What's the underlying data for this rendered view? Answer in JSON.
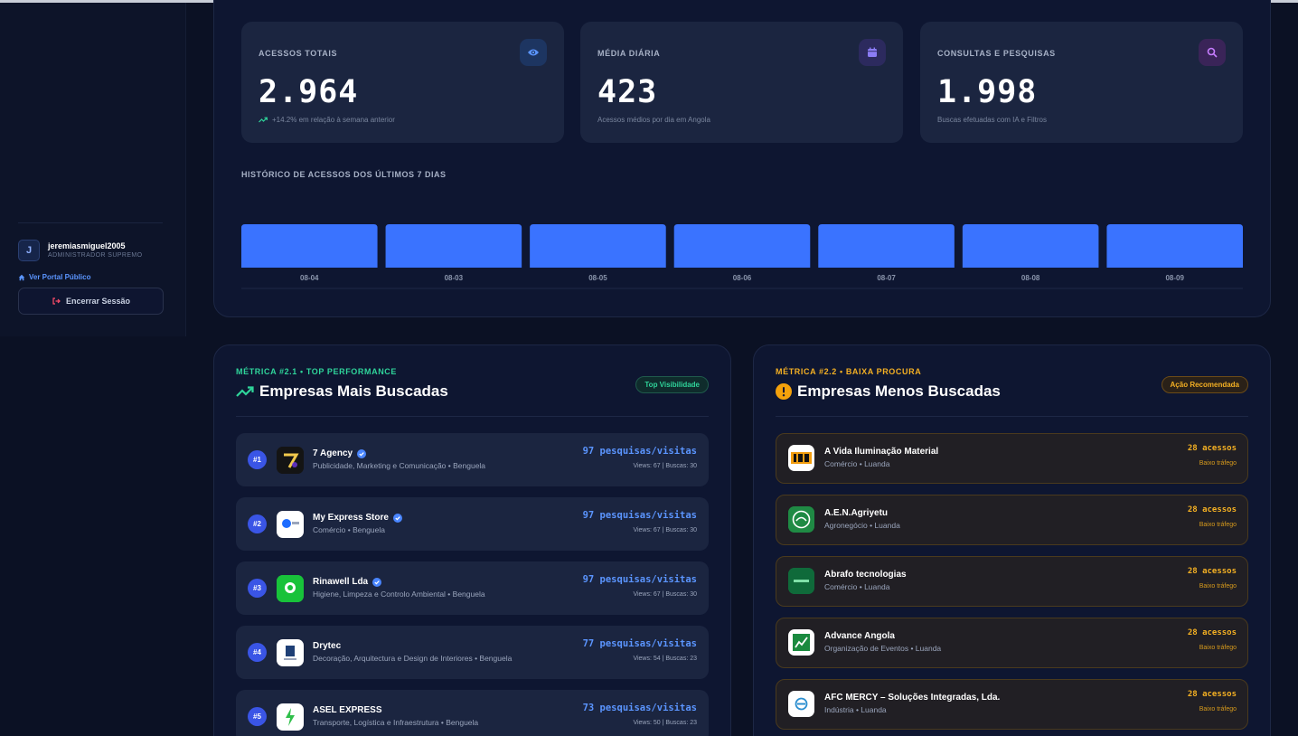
{
  "sidebar": {
    "user_initial": "J",
    "user_name": "jeremiasmiguel2005",
    "user_role": "ADMINISTRADOR SUPREMO",
    "portal_link": "Ver Portal Público",
    "logout_label": "Encerrar Sessão"
  },
  "stats": [
    {
      "label": "ACESSOS TOTAIS",
      "value": "2.964",
      "note": "+14.2% em relação à semana anterior",
      "icon": "eye-icon"
    },
    {
      "label": "MÉDIA DIÁRIA",
      "value": "423",
      "note": "Acessos médios por dia em Angola",
      "icon": "calendar-icon"
    },
    {
      "label": "CONSULTAS E PESQUISAS",
      "value": "1.998",
      "note": "Buscas efetuadas com IA e Filtros",
      "icon": "search-icon"
    }
  ],
  "history_title": "HISTÓRICO DE ACESSOS DOS ÚLTIMOS 7 DIAS",
  "chart_data": {
    "type": "bar",
    "categories": [
      "08-04",
      "08-03",
      "08-05",
      "08-06",
      "08-07",
      "08-08",
      "08-09"
    ],
    "values": [
      1,
      1,
      1,
      1,
      1,
      1,
      1
    ],
    "title": "HISTÓRICO DE ACESSOS DOS ÚLTIMOS 7 DIAS",
    "bar_color": "#3a73ff",
    "grid": false
  },
  "top": {
    "tag": "MÉTRICA #2.1 • TOP PERFORMANCE",
    "title": "Empresas Mais Buscadas",
    "badge": "Top Visibilidade",
    "items": [
      {
        "rank": "#1",
        "name": "7 Agency",
        "sub": "Publicidade, Marketing e Comunicação • Benguela",
        "stat": "97 pesquisas/visitas",
        "meta": "Views: 67 | Buscas: 30",
        "verified": true
      },
      {
        "rank": "#2",
        "name": "My Express Store",
        "sub": "Comércio • Benguela",
        "stat": "97 pesquisas/visitas",
        "meta": "Views: 67 | Buscas: 30",
        "verified": true
      },
      {
        "rank": "#3",
        "name": "Rinawell Lda",
        "sub": "Higiene, Limpeza e Controlo Ambiental • Benguela",
        "stat": "97 pesquisas/visitas",
        "meta": "Views: 67 | Buscas: 30",
        "verified": true
      },
      {
        "rank": "#4",
        "name": "Drytec",
        "sub": "Decoração, Arquitectura e Design de Interiores • Benguela",
        "stat": "77 pesquisas/visitas",
        "meta": "Views: 54 | Buscas: 23",
        "verified": false
      },
      {
        "rank": "#5",
        "name": "ASEL EXPRESS",
        "sub": "Transporte, Logística e Infraestrutura • Benguela",
        "stat": "73 pesquisas/visitas",
        "meta": "Views: 50 | Buscas: 23",
        "verified": false
      }
    ]
  },
  "low": {
    "tag": "MÉTRICA #2.2 • BAIXA PROCURA",
    "title": "Empresas Menos Buscadas",
    "badge": "Ação Recomendada",
    "items": [
      {
        "name": "A Vida Iluminação Material",
        "sub": "Comércio • Luanda",
        "stat": "28 acessos",
        "meta": "Baixo tráfego"
      },
      {
        "name": "A.E.N.Agriyetu",
        "sub": "Agronegócio • Luanda",
        "stat": "28 acessos",
        "meta": "Baixo tráfego"
      },
      {
        "name": "Abrafo tecnologias",
        "sub": "Comércio • Luanda",
        "stat": "28 acessos",
        "meta": "Baixo tráfego"
      },
      {
        "name": "Advance Angola",
        "sub": "Organização de Eventos • Luanda",
        "stat": "28 acessos",
        "meta": "Baixo tráfego"
      },
      {
        "name": "AFC MERCY – Soluções Integradas, Lda.",
        "sub": "Indústria • Luanda",
        "stat": "28 acessos",
        "meta": "Baixo tráfego"
      }
    ]
  },
  "colors": {
    "accent_blue": "#5b95ff",
    "green": "#2fd49a",
    "amber": "#f4b023"
  }
}
